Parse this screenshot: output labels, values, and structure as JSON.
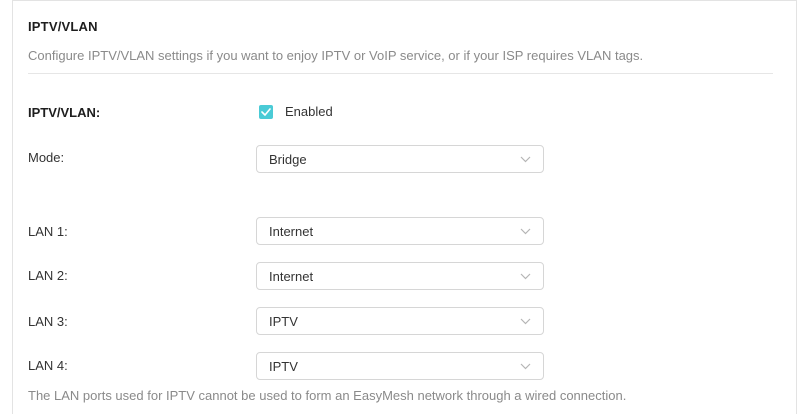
{
  "section": {
    "title": "IPTV/VLAN",
    "description": "Configure IPTV/VLAN settings if you want to enjoy IPTV or VoIP service, or if your ISP requires VLAN tags."
  },
  "iptv_vlan": {
    "label": "IPTV/VLAN:",
    "checkbox_label": "Enabled",
    "checked": true
  },
  "mode": {
    "label": "Mode:",
    "value": "Bridge"
  },
  "lan_ports": [
    {
      "label": "LAN 1:",
      "value": "Internet"
    },
    {
      "label": "LAN 2:",
      "value": "Internet"
    },
    {
      "label": "LAN 3:",
      "value": "IPTV"
    },
    {
      "label": "LAN 4:",
      "value": "IPTV"
    }
  ],
  "note": "The LAN ports used for IPTV cannot be used to form an EasyMesh network through a wired connection.",
  "colors": {
    "accent": "#4acbd6",
    "text": "#333333",
    "muted": "#8a8a8a",
    "border": "#d6d6d6"
  }
}
